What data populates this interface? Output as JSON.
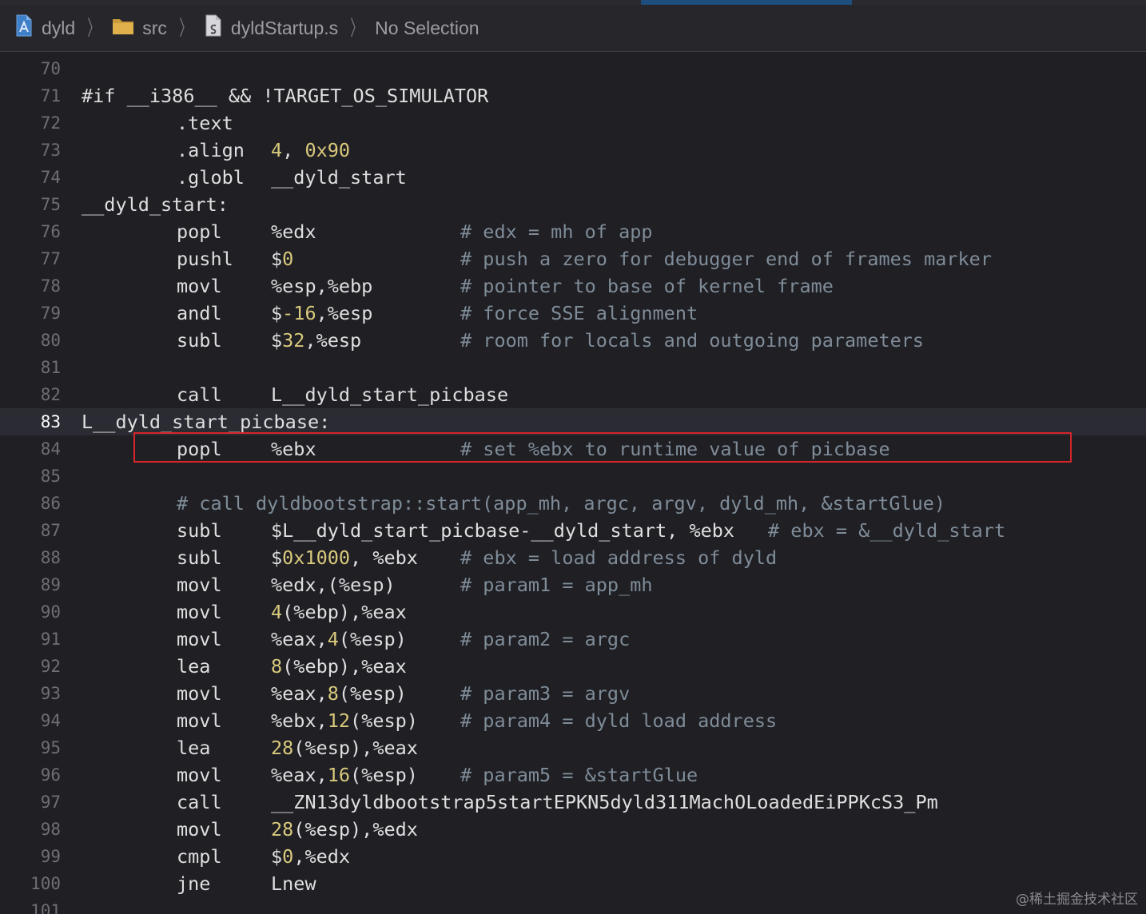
{
  "jumpbar": {
    "project": "dyld",
    "folder": "src",
    "file": "dyldStartup.s",
    "selection": "No Selection",
    "separator": "〉"
  },
  "icons": {
    "project": "xcode-project-icon",
    "folder": "folder-icon",
    "file": "assembly-file-icon"
  },
  "colors": {
    "background": "#1f1f24",
    "number_literal": "#d9c97c",
    "comment": "#7f8c98",
    "highlight_box": "#d6262a"
  },
  "current_line": "83",
  "watermark": "@稀土掘金技术社区",
  "lines": [
    {
      "n": "70",
      "label": "",
      "inst": "",
      "ops": [],
      "comment": ""
    },
    {
      "n": "71",
      "label": "#if __i386__ && !TARGET_OS_SIMULATOR",
      "inst": "",
      "ops": [],
      "comment": ""
    },
    {
      "n": "72",
      "label": "",
      "inst": ".text",
      "ops": [],
      "comment": ""
    },
    {
      "n": "73",
      "label": "",
      "inst": ".align",
      "ops": [
        {
          "t": "4",
          "num": true
        },
        {
          "t": ", "
        },
        {
          "t": "0x90",
          "num": true
        }
      ],
      "comment": ""
    },
    {
      "n": "74",
      "label": "",
      "inst": ".globl",
      "ops": [
        {
          "t": "__dyld_start"
        }
      ],
      "comment": ""
    },
    {
      "n": "75",
      "label": "__dyld_start:",
      "inst": "",
      "ops": [],
      "comment": ""
    },
    {
      "n": "76",
      "label": "",
      "inst": "popl",
      "ops": [
        {
          "t": "%edx"
        }
      ],
      "comment": "# edx = mh of app"
    },
    {
      "n": "77",
      "label": "",
      "inst": "pushl",
      "ops": [
        {
          "t": "$"
        },
        {
          "t": "0",
          "num": true
        }
      ],
      "comment": "# push a zero for debugger end of frames marker"
    },
    {
      "n": "78",
      "label": "",
      "inst": "movl",
      "ops": [
        {
          "t": "%esp,%ebp"
        }
      ],
      "comment": "# pointer to base of kernel frame"
    },
    {
      "n": "79",
      "label": "",
      "inst": "andl",
      "ops": [
        {
          "t": "$"
        },
        {
          "t": "-16",
          "num": true
        },
        {
          "t": ",%esp"
        }
      ],
      "comment": "# force SSE alignment"
    },
    {
      "n": "80",
      "label": "",
      "inst": "subl",
      "ops": [
        {
          "t": "$"
        },
        {
          "t": "32",
          "num": true
        },
        {
          "t": ",%esp"
        }
      ],
      "comment": "# room for locals and outgoing parameters"
    },
    {
      "n": "81",
      "label": "",
      "inst": "",
      "ops": [],
      "comment": ""
    },
    {
      "n": "82",
      "label": "",
      "inst": "call",
      "ops": [
        {
          "t": "L__dyld_start_picbase"
        }
      ],
      "comment": ""
    },
    {
      "n": "83",
      "label": "L__dyld_start_picbase:",
      "inst": "",
      "ops": [],
      "comment": ""
    },
    {
      "n": "84",
      "label": "",
      "inst": "popl",
      "ops": [
        {
          "t": "%ebx"
        }
      ],
      "comment": "# set %ebx to runtime value of picbase"
    },
    {
      "n": "85",
      "label": "",
      "inst": "",
      "ops": [],
      "comment": ""
    },
    {
      "n": "86",
      "label": "",
      "inst": "",
      "ops": [],
      "comment": "",
      "fullcomment": "# call dyldbootstrap::start(app_mh, argc, argv, dyld_mh, &startGlue)"
    },
    {
      "n": "87",
      "label": "",
      "inst": "subl",
      "ops": [
        {
          "t": "$L__dyld_start_picbase-__dyld_start, %ebx"
        }
      ],
      "comment": "",
      "comment2": "# ebx = &__dyld_start"
    },
    {
      "n": "88",
      "label": "",
      "inst": "subl",
      "ops": [
        {
          "t": "$"
        },
        {
          "t": "0x1000",
          "num": true
        },
        {
          "t": ", %ebx"
        }
      ],
      "comment": "# ebx = load address of dyld"
    },
    {
      "n": "89",
      "label": "",
      "inst": "movl",
      "ops": [
        {
          "t": "%edx,(%esp)"
        }
      ],
      "comment": "# param1 = app_mh"
    },
    {
      "n": "90",
      "label": "",
      "inst": "movl",
      "ops": [
        {
          "t": "4",
          "num": true
        },
        {
          "t": "(%ebp),%eax"
        }
      ],
      "comment": ""
    },
    {
      "n": "91",
      "label": "",
      "inst": "movl",
      "ops": [
        {
          "t": "%eax,"
        },
        {
          "t": "4",
          "num": true
        },
        {
          "t": "(%esp)"
        }
      ],
      "comment": "# param2 = argc"
    },
    {
      "n": "92",
      "label": "",
      "inst": "lea",
      "ops": [
        {
          "t": "8",
          "num": true
        },
        {
          "t": "(%ebp),%eax"
        }
      ],
      "comment": ""
    },
    {
      "n": "93",
      "label": "",
      "inst": "movl",
      "ops": [
        {
          "t": "%eax,"
        },
        {
          "t": "8",
          "num": true
        },
        {
          "t": "(%esp)"
        }
      ],
      "comment": "# param3 = argv"
    },
    {
      "n": "94",
      "label": "",
      "inst": "movl",
      "ops": [
        {
          "t": "%ebx,"
        },
        {
          "t": "12",
          "num": true
        },
        {
          "t": "(%esp)"
        }
      ],
      "comment": "# param4 = dyld load address"
    },
    {
      "n": "95",
      "label": "",
      "inst": "lea",
      "ops": [
        {
          "t": "28",
          "num": true
        },
        {
          "t": "(%esp),%eax"
        }
      ],
      "comment": ""
    },
    {
      "n": "96",
      "label": "",
      "inst": "movl",
      "ops": [
        {
          "t": "%eax,"
        },
        {
          "t": "16",
          "num": true
        },
        {
          "t": "(%esp)"
        }
      ],
      "comment": "# param5 = &startGlue"
    },
    {
      "n": "97",
      "label": "",
      "inst": "call",
      "ops": [
        {
          "t": "__ZN13dyldbootstrap5startEPKN5dyld311MachOLoadedEiPPKcS3_Pm"
        }
      ],
      "comment": ""
    },
    {
      "n": "98",
      "label": "",
      "inst": "movl",
      "ops": [
        {
          "t": "28",
          "num": true
        },
        {
          "t": "(%esp),%edx"
        }
      ],
      "comment": ""
    },
    {
      "n": "99",
      "label": "",
      "inst": "cmpl",
      "ops": [
        {
          "t": "$"
        },
        {
          "t": "0",
          "num": true
        },
        {
          "t": ",%edx"
        }
      ],
      "comment": ""
    },
    {
      "n": "100",
      "label": "",
      "inst": "jne",
      "ops": [
        {
          "t": "Lnew"
        }
      ],
      "comment": ""
    },
    {
      "n": "101",
      "label": "",
      "inst": "",
      "ops": [],
      "comment": ""
    }
  ]
}
